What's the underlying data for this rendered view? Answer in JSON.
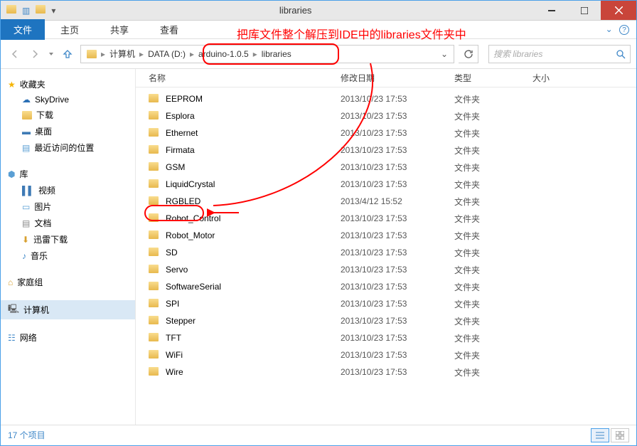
{
  "window": {
    "title": "libraries"
  },
  "ribbon": {
    "file": "文件",
    "tabs": [
      "主页",
      "共享",
      "查看"
    ]
  },
  "annotation": "把库文件整个解压到IDE中的libraries文件夹中",
  "breadcrumb": {
    "segs": [
      "计算机",
      "DATA (D:)",
      "arduino-1.0.5",
      "libraries"
    ]
  },
  "search": {
    "placeholder": "搜索 libraries"
  },
  "sidebar": {
    "favorites": {
      "label": "收藏夹",
      "items": [
        "SkyDrive",
        "下载",
        "桌面",
        "最近访问的位置"
      ]
    },
    "libraries": {
      "label": "库",
      "items": [
        "视频",
        "图片",
        "文档",
        "迅雷下载",
        "音乐"
      ]
    },
    "homegroup": {
      "label": "家庭组"
    },
    "computer": {
      "label": "计算机"
    },
    "network": {
      "label": "网络"
    }
  },
  "columns": {
    "name": "名称",
    "date": "修改日期",
    "type": "类型",
    "size": "大小"
  },
  "files": [
    {
      "name": "EEPROM",
      "date": "2013/10/23 17:53",
      "type": "文件夹"
    },
    {
      "name": "Esplora",
      "date": "2013/10/23 17:53",
      "type": "文件夹"
    },
    {
      "name": "Ethernet",
      "date": "2013/10/23 17:53",
      "type": "文件夹"
    },
    {
      "name": "Firmata",
      "date": "2013/10/23 17:53",
      "type": "文件夹"
    },
    {
      "name": "GSM",
      "date": "2013/10/23 17:53",
      "type": "文件夹"
    },
    {
      "name": "LiquidCrystal",
      "date": "2013/10/23 17:53",
      "type": "文件夹"
    },
    {
      "name": "RGBLED",
      "date": "2013/4/12 15:52",
      "type": "文件夹"
    },
    {
      "name": "Robot_Control",
      "date": "2013/10/23 17:53",
      "type": "文件夹"
    },
    {
      "name": "Robot_Motor",
      "date": "2013/10/23 17:53",
      "type": "文件夹"
    },
    {
      "name": "SD",
      "date": "2013/10/23 17:53",
      "type": "文件夹"
    },
    {
      "name": "Servo",
      "date": "2013/10/23 17:53",
      "type": "文件夹"
    },
    {
      "name": "SoftwareSerial",
      "date": "2013/10/23 17:53",
      "type": "文件夹"
    },
    {
      "name": "SPI",
      "date": "2013/10/23 17:53",
      "type": "文件夹"
    },
    {
      "name": "Stepper",
      "date": "2013/10/23 17:53",
      "type": "文件夹"
    },
    {
      "name": "TFT",
      "date": "2013/10/23 17:53",
      "type": "文件夹"
    },
    {
      "name": "WiFi",
      "date": "2013/10/23 17:53",
      "type": "文件夹"
    },
    {
      "name": "Wire",
      "date": "2013/10/23 17:53",
      "type": "文件夹"
    }
  ],
  "status": {
    "count": "17 个项目"
  }
}
